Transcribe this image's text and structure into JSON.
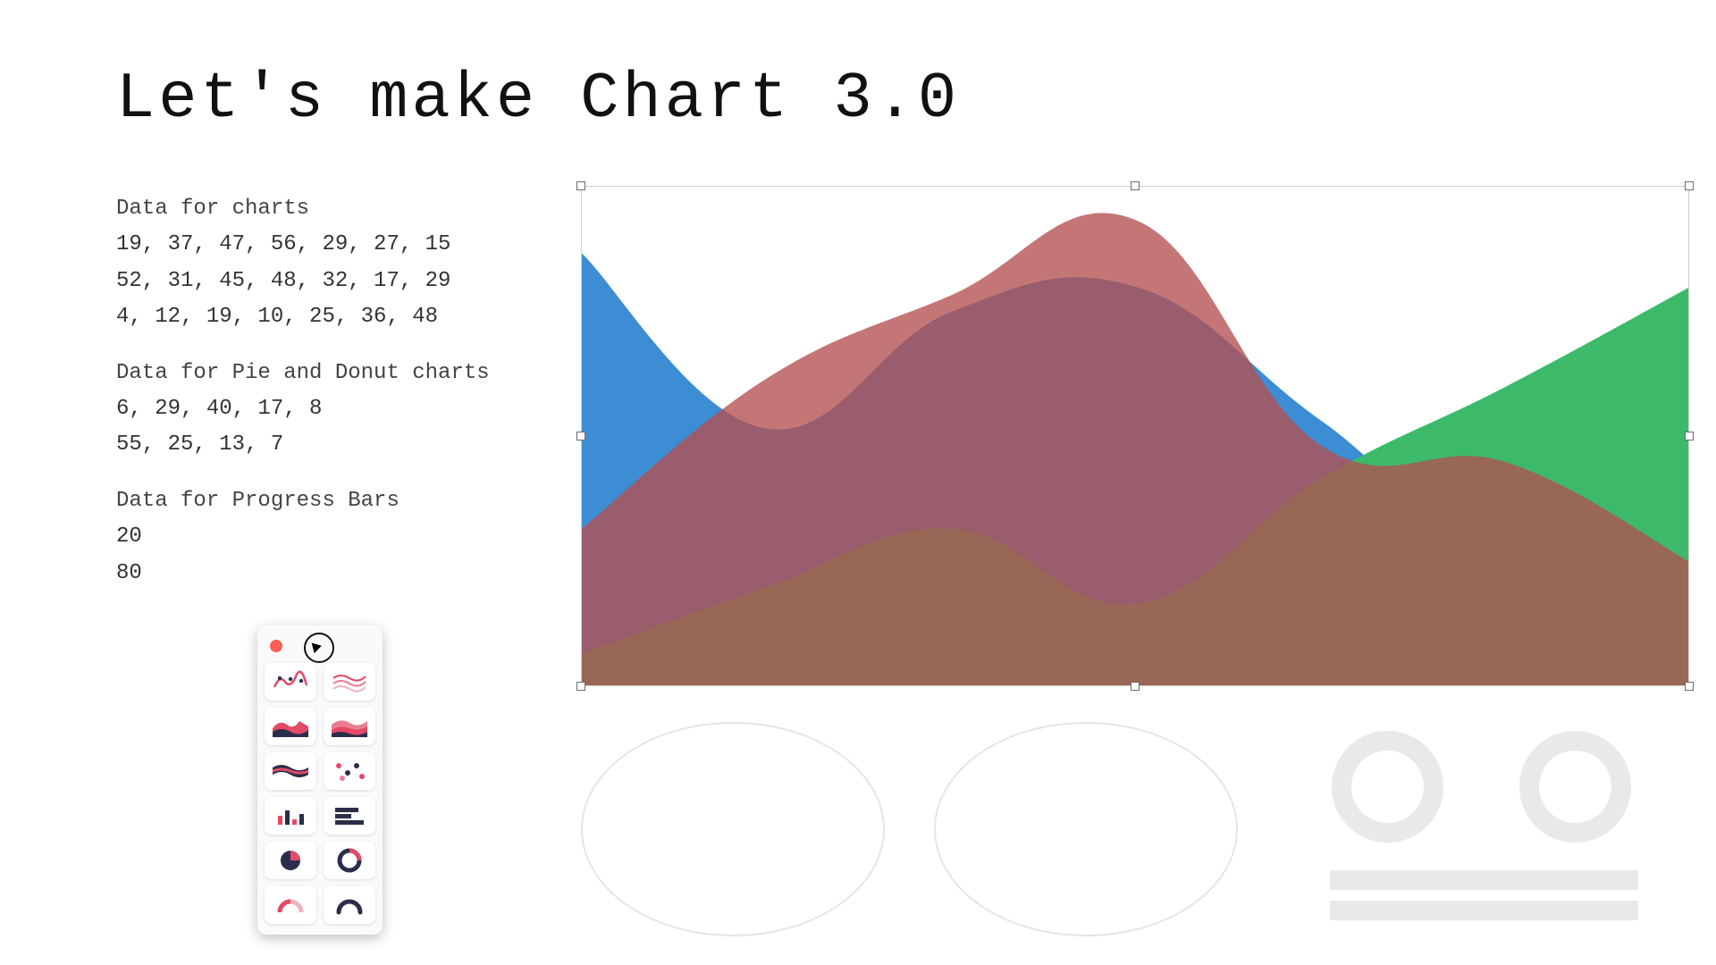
{
  "title": "Let's make Chart 3.0",
  "sections": {
    "charts_heading": "Data for charts",
    "charts_rows": [
      "19, 37, 47, 56, 29, 27, 15",
      "52, 31, 45, 48, 32, 17, 29",
      "4, 12, 19, 10, 25, 36, 48"
    ],
    "pie_heading": "Data for Pie and Donut charts",
    "pie_rows": [
      "6, 29, 40, 17, 8",
      "55, 25, 13, 7"
    ],
    "progress_heading": "Data for Progress Bars",
    "progress_rows": [
      "20",
      "80"
    ]
  },
  "palette": {
    "tools": [
      "line-chart",
      "multi-line-chart",
      "area-chart",
      "stacked-area-chart",
      "stream-chart",
      "scatter-chart",
      "bar-chart-vertical",
      "bar-chart-horizontal",
      "pie-chart",
      "donut-chart",
      "half-donut-chart",
      "gauge-chart"
    ]
  },
  "colors": {
    "series_blue": "#3d8dd4",
    "series_red": "#d15a5a",
    "series_green": "#3cba6a",
    "series_red_translucent": "rgba(180,80,80,0.78)",
    "palette_pink": "#e24a68",
    "palette_navy": "#2b2e4a"
  },
  "chart_data": {
    "type": "area",
    "note": "Stacked/overlaid smooth area chart with 3 series over 7 ordinal x positions. No axes, ticks, labels, or legend are shown; values are estimated from relative heights (scale approx 0–60 where 60 = full chart height).",
    "x": [
      0,
      1,
      2,
      3,
      4,
      5,
      6
    ],
    "series": [
      {
        "name": "blue",
        "color": "#3d8dd4",
        "values": [
          52,
          31,
          45,
          48,
          32,
          17,
          29
        ]
      },
      {
        "name": "red",
        "color": "#d15a5a",
        "values": [
          19,
          37,
          47,
          56,
          29,
          27,
          15
        ]
      },
      {
        "name": "green",
        "color": "#3cba6a",
        "values": [
          4,
          12,
          19,
          10,
          25,
          36,
          48
        ]
      }
    ],
    "ylim": [
      0,
      60
    ],
    "axes_visible": false,
    "legend_visible": false
  }
}
